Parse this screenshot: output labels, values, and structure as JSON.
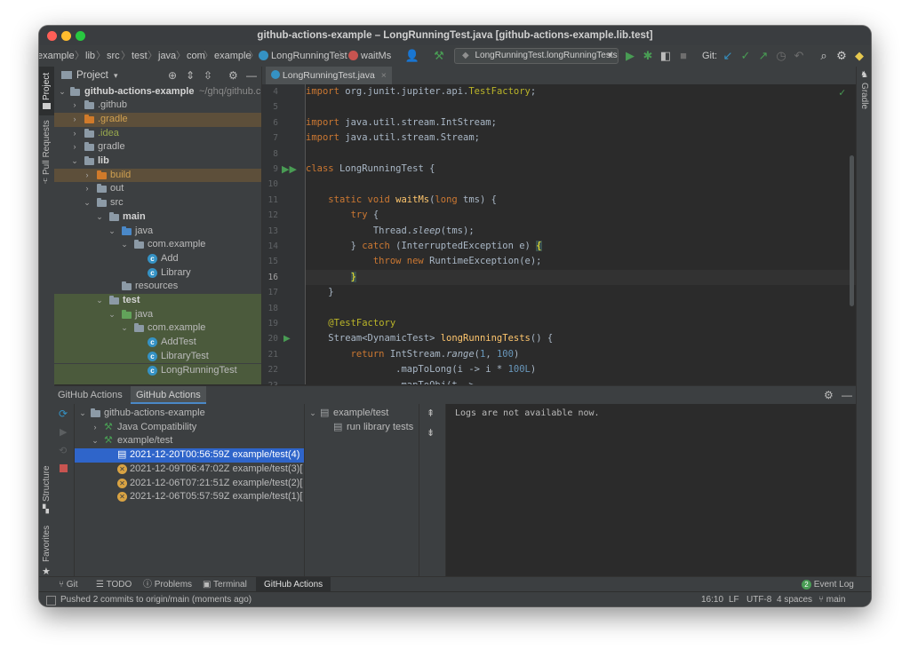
{
  "window": {
    "title": "github-actions-example – LongRunningTest.java [github-actions-example.lib.test]"
  },
  "navbar": {
    "breadcrumbs": [
      "example",
      "lib",
      "src",
      "test",
      "java",
      "com",
      "example",
      "LongRunningTest",
      "waitMs"
    ],
    "run_config": "LongRunningTest.longRunningTests",
    "git_label": "Git:"
  },
  "left_stripe": {
    "project": "Project",
    "pull_requests": "Pull Requests",
    "structure": "Structure",
    "favorites": "Favorites"
  },
  "right_stripe": {
    "gradle": "Gradle"
  },
  "project_panel": {
    "title": "Project",
    "rows": [
      {
        "label": "github-actions-example",
        "suffix": "~/ghq/github.c"
      },
      {
        "label": ".github"
      },
      {
        "label": ".gradle"
      },
      {
        "label": ".idea"
      },
      {
        "label": "gradle"
      },
      {
        "label": "lib"
      },
      {
        "label": "build"
      },
      {
        "label": "out"
      },
      {
        "label": "src"
      },
      {
        "label": "main"
      },
      {
        "label": "java"
      },
      {
        "label": "com.example"
      },
      {
        "label": "Add"
      },
      {
        "label": "Library"
      },
      {
        "label": "resources"
      },
      {
        "label": "test"
      },
      {
        "label": "java"
      },
      {
        "label": "com.example"
      },
      {
        "label": "AddTest"
      },
      {
        "label": "LibraryTest"
      },
      {
        "label": "LongRunningTest"
      }
    ]
  },
  "editor": {
    "tab_label": "LongRunningTest.java",
    "line_numbers": [
      "4",
      "5",
      "6",
      "7",
      "8",
      "9",
      "10",
      "11",
      "12",
      "13",
      "14",
      "15",
      "16",
      "17",
      "18",
      "19",
      "20",
      "21",
      "22",
      "23"
    ]
  },
  "bottom": {
    "tabs": [
      "GitHub Actions",
      "GitHub Actions"
    ],
    "tree": [
      {
        "label": "github-actions-example"
      },
      {
        "label": "Java Compatibility"
      },
      {
        "label": "example/test"
      },
      {
        "label": "2021-12-20T00:56:59Z example/test(4)"
      },
      {
        "label": "2021-12-09T06:47:02Z example/test(3)["
      },
      {
        "label": "2021-12-06T07:21:51Z example/test(2)["
      },
      {
        "label": "2021-12-06T05:57:59Z example/test(1)["
      }
    ],
    "jobs": [
      {
        "label": "example/test"
      },
      {
        "label": "run library tests"
      }
    ],
    "log_text": "Logs are not available now."
  },
  "tool_tabs": [
    "Git",
    "TODO",
    "Problems",
    "Terminal",
    "GitHub Actions"
  ],
  "event_log": {
    "count": "2",
    "label": "Event Log"
  },
  "status": {
    "message": "Pushed 2 commits to origin/main (moments ago)",
    "position": "16:10",
    "line_sep": "LF",
    "encoding": "UTF-8",
    "indent": "4 spaces",
    "branch": "main"
  },
  "colors": {
    "accent": "#4a88c7",
    "selection": "#2f65ca",
    "run_green": "#499c54",
    "warn": "#d9a343"
  }
}
